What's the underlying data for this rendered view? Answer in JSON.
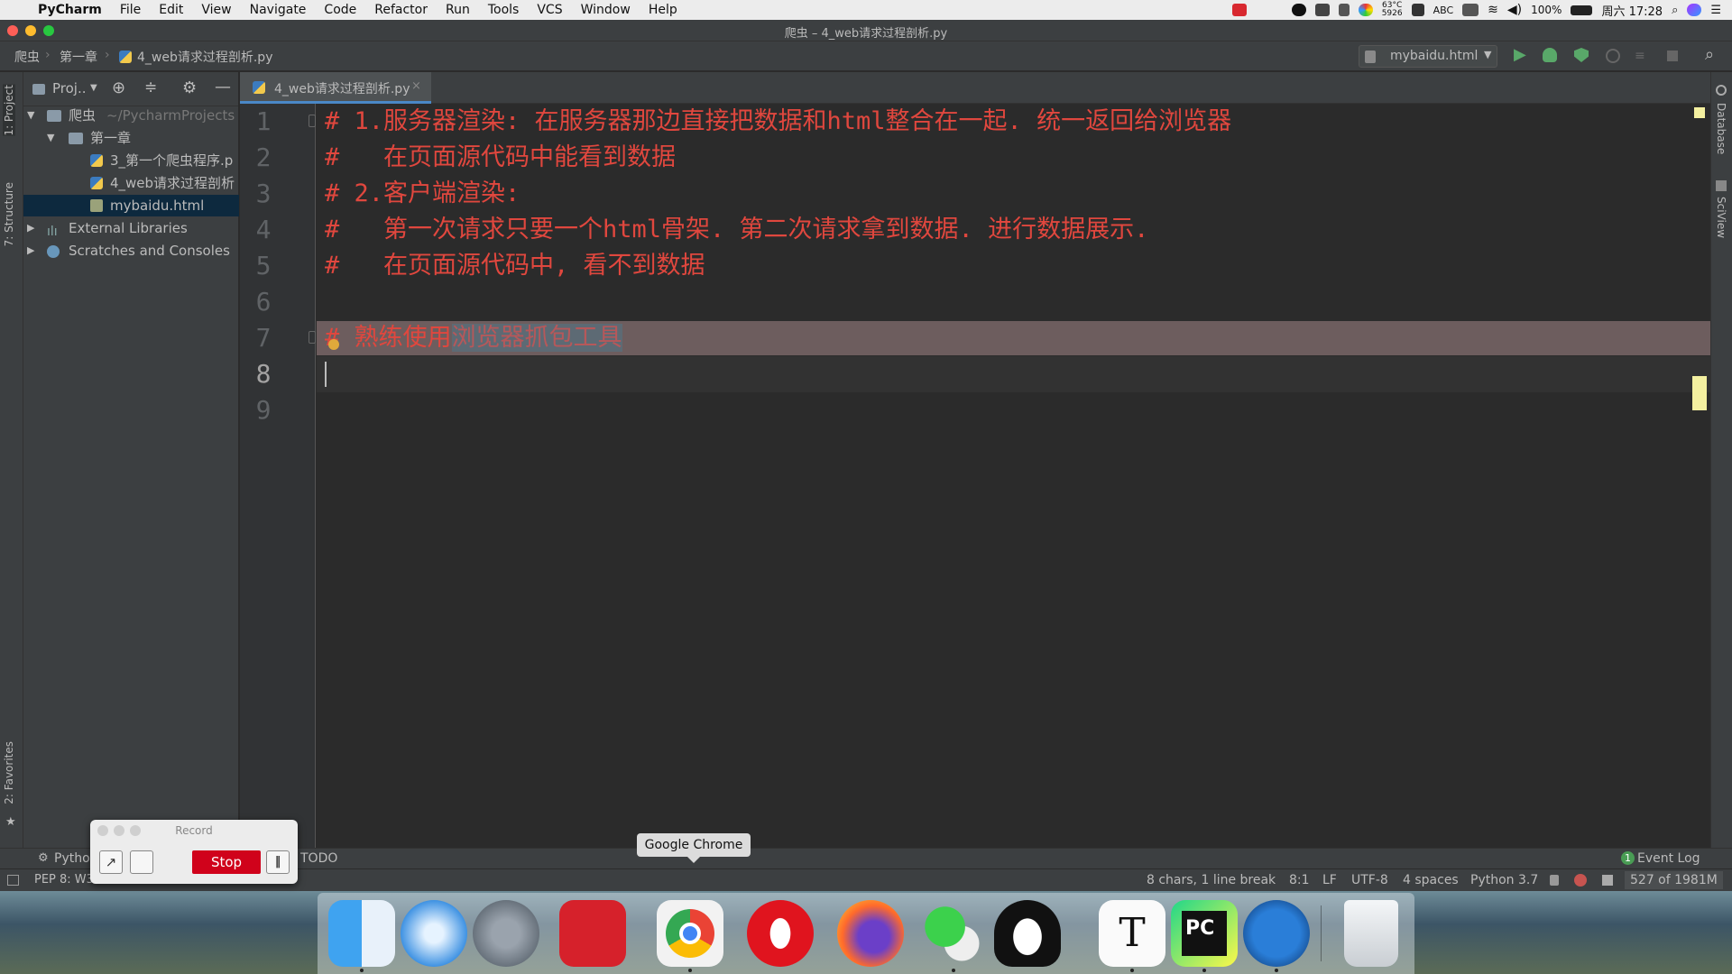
{
  "menubar": {
    "app": "PyCharm",
    "items": [
      "File",
      "Edit",
      "View",
      "Navigate",
      "Code",
      "Refactor",
      "Run",
      "Tools",
      "VCS",
      "Window",
      "Help"
    ],
    "temp": "63°C",
    "fan": "5926",
    "input": "ABC",
    "battery": "100%",
    "clock": "周六 17:28"
  },
  "window": {
    "title": "爬虫 – 4_web请求过程剖析.py"
  },
  "navbar": {
    "crumbs": [
      "爬虫",
      "第一章",
      "4_web请求过程剖析.py"
    ],
    "run_config": "mybaidu.html"
  },
  "project": {
    "header": "Proj..",
    "tree": [
      {
        "label": "爬虫",
        "suffix": "~/PycharmProjects"
      },
      {
        "label": "第一章"
      },
      {
        "label": "3_第一个爬虫程序.p"
      },
      {
        "label": "4_web请求过程剖析"
      },
      {
        "label": "mybaidu.html"
      },
      {
        "label": "External Libraries"
      },
      {
        "label": "Scratches and Consoles"
      }
    ]
  },
  "left_tabs": {
    "project": "1: Project",
    "structure": "7: Structure",
    "favorites": "2: Favorites"
  },
  "right_tabs": {
    "database": "Database",
    "sciview": "SciView"
  },
  "editor": {
    "tab_label": "4_web请求过程剖析.py",
    "line_numbers": [
      "1",
      "2",
      "3",
      "4",
      "5",
      "6",
      "7",
      "8",
      "9"
    ],
    "lines": [
      "# 1.服务器渲染: 在服务器那边直接把数据和html整合在一起. 统一返回给浏览器",
      "#   在页面源代码中能看到数据",
      "# 2.客户端渲染:",
      "#   第一次请求只要一个html骨架. 第二次请求拿到数据. 进行数据展示.",
      "#   在页面源代码中, 看不到数据",
      "",
      "# 熟练使用",
      "",
      ""
    ],
    "selected_text": "浏览器抓包工具"
  },
  "bottom_tabs": {
    "python": "Python",
    "todo": "TODO",
    "event_log": "Event Log",
    "event_count": "1"
  },
  "status": {
    "message": "PEP 8: W3",
    "selection": "8 chars, 1 line break",
    "position": "8:1",
    "line_sep": "LF",
    "encoding": "UTF-8",
    "indent": "4 spaces",
    "interpreter": "Python 3.7",
    "memory": "527 of 1981M"
  },
  "record": {
    "title": "Record",
    "stop": "Stop"
  },
  "tooltip": "Google Chrome",
  "dock": [
    "finder-icon",
    "safari-icon",
    "launchpad-icon",
    "netease-music-icon",
    "chrome-icon",
    "opera-icon",
    "firefox-icon",
    "wechat-icon",
    "qq-icon",
    "typora-icon",
    "pycharm-icon",
    "thunder-icon",
    "trash-icon"
  ]
}
